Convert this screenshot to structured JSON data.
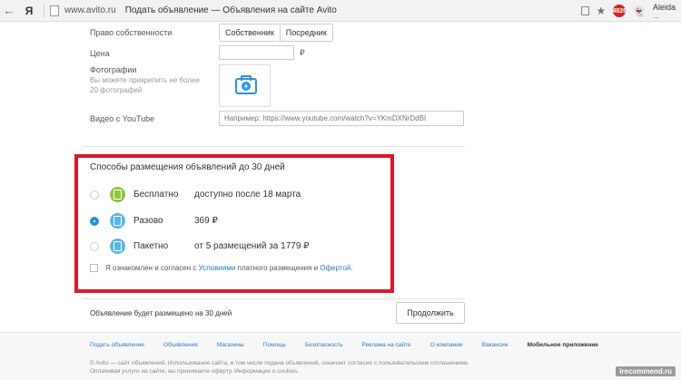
{
  "browser": {
    "back_glyph": "←",
    "logo": "Я",
    "url_host": "www.avito.ru",
    "tab_title": "Подать объявление — Объявления на сайте Avito",
    "ext_badge": "4826",
    "user_name": "Aleida",
    "user_sub": "..."
  },
  "form": {
    "ownership_label": "Право собственности",
    "ownership_options": [
      "Собственник",
      "Посредник"
    ],
    "price_label": "Цена",
    "currency": "₽",
    "photos_label": "Фотографии",
    "photos_hint": "Вы можете прикрепить не более 20 фотографий",
    "youtube_label": "Видео с YouTube",
    "youtube_placeholder": "Например: https://www.youtube.com/watch?v=YKmDXNrDdBI"
  },
  "plans": {
    "title": "Способы размещения объявлений до 30 дней",
    "items": [
      {
        "name": "Бесплатно",
        "desc": "доступно после 18 марта",
        "selected": false,
        "color": "#8dc63f"
      },
      {
        "name": "Разово",
        "desc": "369 ₽",
        "selected": true,
        "color": "#58b7e6"
      },
      {
        "name": "Пакетно",
        "desc": "от 5 размещений за 1779 ₽",
        "selected": false,
        "color": "#58b7e6"
      }
    ],
    "agree_prefix": "Я ознакомлен и согласен с",
    "agree_link1": "Условиями",
    "agree_middle": "платного размещения и",
    "agree_link2": "Офертой",
    "agree_suffix": "."
  },
  "submit": {
    "note": "Объявление будет размещено на 30 дней",
    "continue_label": "Продолжить"
  },
  "footer": {
    "links": [
      "Подать объявление",
      "Объявления",
      "Магазины",
      "Помощь",
      "Безопасность",
      "Реклама на сайте",
      "О компании",
      "Вакансии",
      "Мобильное приложение"
    ],
    "copyright": "© Avito — сайт объявлений. Использование сайта, в том числе подача объявлений, означает согласие с пользовательским соглашением. Оплачивая услуги на сайте, вы принимаете оферту. Информация о cookies."
  },
  "watermark": "irecommend.ru",
  "colors": {
    "highlight": "#e2162b",
    "accent": "#2a94d6"
  }
}
